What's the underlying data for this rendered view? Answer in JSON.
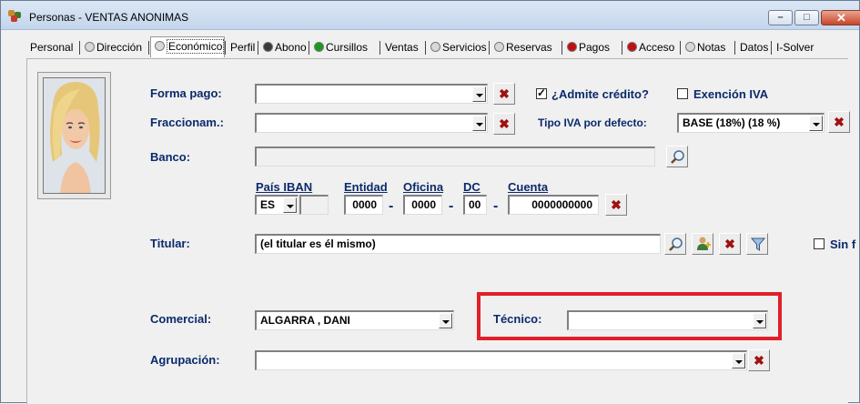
{
  "window": {
    "title": "Personas - VENTAS ANONIMAS",
    "minimize_glyph": "–",
    "maximize_glyph": "□",
    "close_glyph": "✕"
  },
  "tabs": [
    {
      "label": "Personal",
      "dot": null
    },
    {
      "label": "Dirección",
      "dot": "#d8d8d8"
    },
    {
      "label": "Económico",
      "dot": "#d8d8d8"
    },
    {
      "label": "Perfil",
      "dot": null
    },
    {
      "label": "Abono",
      "dot": "#3a3a3a"
    },
    {
      "label": "Cursillos",
      "dot": "#1a9a1a"
    },
    {
      "label": "Ventas",
      "dot": null
    },
    {
      "label": "Servicios",
      "dot": "#d8d8d8"
    },
    {
      "label": "Reservas",
      "dot": "#d8d8d8"
    },
    {
      "label": "Pagos",
      "dot": "#c01010"
    },
    {
      "label": "Acceso",
      "dot": "#c01010"
    },
    {
      "label": "Notas",
      "dot": "#d8d8d8"
    },
    {
      "label": "Datos",
      "dot": null
    },
    {
      "label": "I-Solver",
      "dot": null
    }
  ],
  "active_tab": "Económico",
  "form": {
    "forma_pago": {
      "label": "Forma pago:",
      "value": ""
    },
    "admite_credito": {
      "label": "¿Admite crédito?",
      "checked": true
    },
    "exencion_iva": {
      "label": "Exención IVA",
      "checked": false
    },
    "fraccionam": {
      "label": "Fraccionam.:",
      "value": ""
    },
    "tipo_iva": {
      "label": "Tipo IVA por defecto:",
      "value": "BASE (18%)  (18 %)"
    },
    "banco": {
      "label": "Banco:",
      "value": ""
    },
    "iban": {
      "pais_label": "País IBAN",
      "entidad_label": "Entidad",
      "oficina_label": "Oficina",
      "dc_label": "DC",
      "cuenta_label": "Cuenta",
      "pais_value": "ES",
      "check_digits": "",
      "entidad_value": "0000",
      "oficina_value": "0000",
      "dc_value": "00",
      "cuenta_value": "0000000000",
      "separator": "-"
    },
    "titular": {
      "label": "Titular:",
      "value": "(el titular es él mismo)"
    },
    "sin_label": "Sin f",
    "comercial": {
      "label": "Comercial:",
      "value": "ALGARRA , DANI"
    },
    "tecnico": {
      "label": "Técnico:",
      "value": ""
    },
    "agrupacion": {
      "label": "Agrupación:",
      "value": ""
    }
  },
  "icons": {
    "delete": "✖",
    "search": "search-icon",
    "add_person": "add-person-icon",
    "filter": "filter-icon"
  },
  "colors": {
    "label_blue": "#0a2a6b",
    "highlight_red": "#e0202a",
    "delete_red": "#a01010"
  }
}
